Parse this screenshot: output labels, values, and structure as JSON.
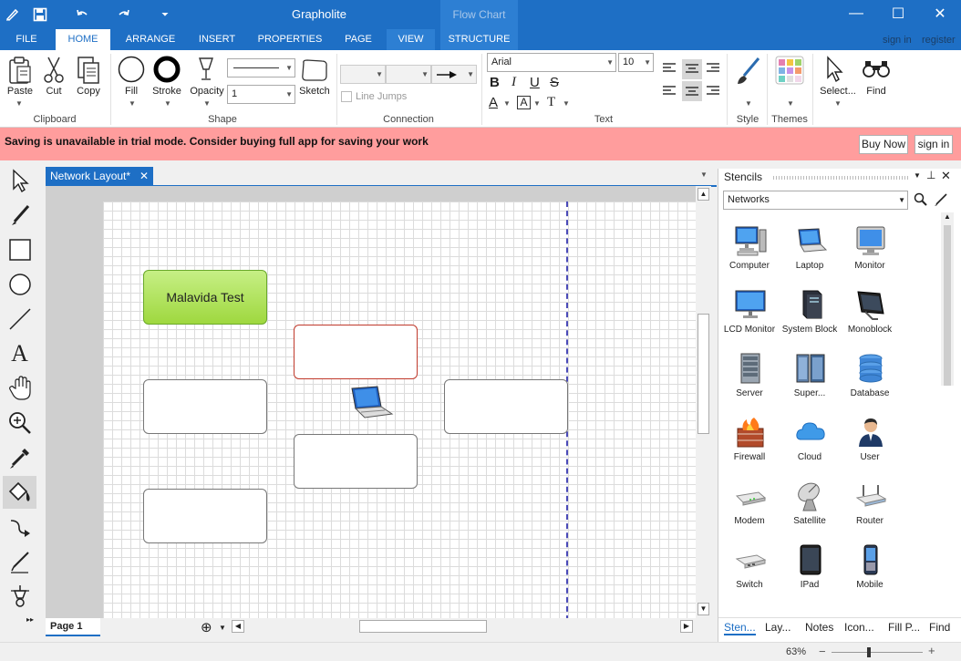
{
  "app": {
    "title": "Grapholite",
    "context_tab_title": "Flow Chart"
  },
  "tabs": [
    "FILE",
    "HOME",
    "ARRANGE",
    "INSERT",
    "PROPERTIES",
    "PAGE",
    "VIEW",
    "STRUCTURE"
  ],
  "account": {
    "sign_in": "sign in",
    "register": "register"
  },
  "ribbon": {
    "clipboard": {
      "label": "Clipboard",
      "paste": "Paste",
      "cut": "Cut",
      "copy": "Copy"
    },
    "shape": {
      "label": "Shape",
      "fill": "Fill",
      "stroke": "Stroke",
      "opacity": "Opacity",
      "opacity_value": "1",
      "sketch": "Sketch"
    },
    "connection": {
      "label": "Connection",
      "line_jumps": "Line Jumps"
    },
    "text": {
      "label": "Text",
      "font": "Arial",
      "size": "10",
      "bold": "B",
      "italic": "I",
      "underline": "U",
      "strike": "S",
      "color_a": "A",
      "box_a": "A",
      "t": "T"
    },
    "style": {
      "label": "Style"
    },
    "themes": {
      "label": "Themes"
    },
    "select": {
      "label": "Select..."
    },
    "find": {
      "label": "Find"
    }
  },
  "banner": {
    "message": "Saving is unavailable in trial mode. Consider buying full app for saving your work",
    "buy": "Buy Now",
    "sign_in": "sign in"
  },
  "document": {
    "tab": "Network Layout*",
    "page_tab": "Page 1",
    "node_text": "Malavida Test"
  },
  "stencils": {
    "title": "Stencils",
    "category": "Networks",
    "items": [
      "Computer",
      "Laptop",
      "Monitor",
      "LCD Monitor",
      "System Block",
      "Monoblock",
      "Server",
      "Super...",
      "Database",
      "Firewall",
      "Cloud",
      "User",
      "Modem",
      "Satellite",
      "Router",
      "Switch",
      "IPad",
      "Mobile"
    ],
    "bottom_tabs": [
      "Sten...",
      "Lay...",
      "Notes",
      "Icon...",
      "Fill P...",
      "Find"
    ]
  },
  "status": {
    "zoom": "63%"
  },
  "colors": {
    "accent": "#1e6fc5",
    "banner": "#ff9d9d",
    "node_green": "#9fd83f",
    "selected_border": "#c0392b"
  }
}
